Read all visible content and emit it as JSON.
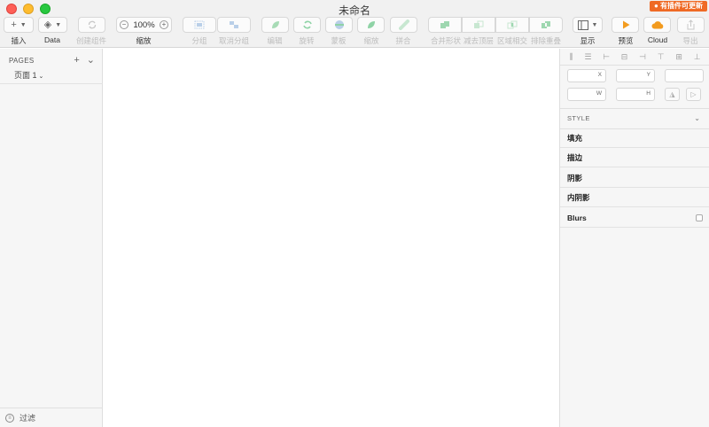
{
  "window": {
    "title": "未命名",
    "update_badge": "● 有插件可更新"
  },
  "toolbar": {
    "insert": {
      "label": "插入",
      "glyph": "+"
    },
    "data": {
      "label": "Data",
      "glyph": "◈"
    },
    "create_symbol": {
      "label": "创建组件"
    },
    "zoom": {
      "label": "缩放",
      "value": "100%",
      "minus": "−",
      "plus": "+"
    },
    "group": {
      "label": "分组"
    },
    "ungroup": {
      "label": "取消分组"
    },
    "edit": {
      "label": "编辑"
    },
    "rotate": {
      "label": "旋转"
    },
    "mask": {
      "label": "蒙板"
    },
    "scale": {
      "label": "缩放"
    },
    "flatten": {
      "label": "拼合"
    },
    "union": {
      "label": "合并形状"
    },
    "subtract": {
      "label": "减去顶层"
    },
    "intersect": {
      "label": "区域相交"
    },
    "difference": {
      "label": "排除重叠"
    },
    "view": {
      "label": "显示"
    },
    "preview": {
      "label": "预览"
    },
    "cloud": {
      "label": "Cloud"
    },
    "export": {
      "label": "导出"
    }
  },
  "sidebar": {
    "pages_title": "PAGES",
    "add_glyph": "+",
    "collapse_glyph": "⌄",
    "pages": [
      {
        "label": "页面 1"
      }
    ],
    "filter_label": "过滤"
  },
  "inspector": {
    "fields": {
      "x": "X",
      "y": "Y",
      "w": "W",
      "h": "H"
    },
    "style_title": "STYLE",
    "sections": [
      "填充",
      "描边",
      "阴影",
      "内阴影",
      "Blurs"
    ]
  },
  "colors": {
    "accent_orange": "#ef6a25",
    "preview_orange": "#f39c1f",
    "cloud_orange": "#f29a1d",
    "shape_green": "#8fd3a6"
  }
}
